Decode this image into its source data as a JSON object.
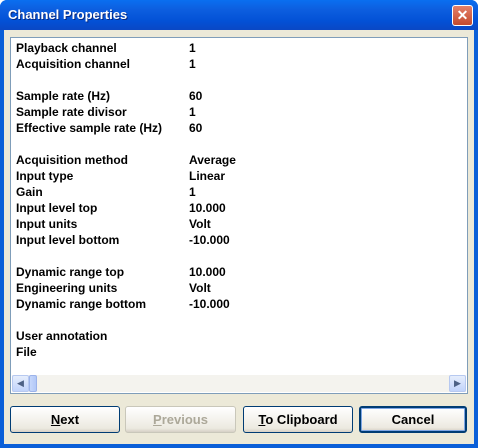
{
  "window": {
    "title": "Channel Properties",
    "close_glyph": "✕"
  },
  "properties": [
    {
      "label": "Playback channel",
      "value": "1"
    },
    {
      "label": "Acquisition channel",
      "value": "1"
    },
    {
      "label": "",
      "value": ""
    },
    {
      "label": "Sample rate (Hz)",
      "value": "60"
    },
    {
      "label": "Sample rate divisor",
      "value": "1"
    },
    {
      "label": "Effective sample rate (Hz)",
      "value": "60"
    },
    {
      "label": "",
      "value": ""
    },
    {
      "label": "Acquisition method",
      "value": "Average"
    },
    {
      "label": "Input type",
      "value": "Linear"
    },
    {
      "label": "Gain",
      "value": "1"
    },
    {
      "label": "Input level top",
      "value": "10.000"
    },
    {
      "label": "Input units",
      "value": "Volt"
    },
    {
      "label": "Input level bottom",
      "value": "-10.000"
    },
    {
      "label": "",
      "value": ""
    },
    {
      "label": "Dynamic range top",
      "value": "10.000"
    },
    {
      "label": "Engineering units",
      "value": "Volt"
    },
    {
      "label": "Dynamic range bottom",
      "value": "-10.000"
    },
    {
      "label": "",
      "value": ""
    },
    {
      "label": "User annotation",
      "value": ""
    },
    {
      "label": "File",
      "value": ""
    }
  ],
  "buttons": {
    "next": {
      "mnemonic": "N",
      "rest": "ext"
    },
    "previous": {
      "mnemonic": "P",
      "rest": "revious"
    },
    "clipboard": {
      "mnemonic": "T",
      "rest": "o Clipboard"
    },
    "cancel": {
      "label": "Cancel"
    }
  },
  "scrollbar": {
    "left_glyph": "◀",
    "right_glyph": "▶"
  }
}
